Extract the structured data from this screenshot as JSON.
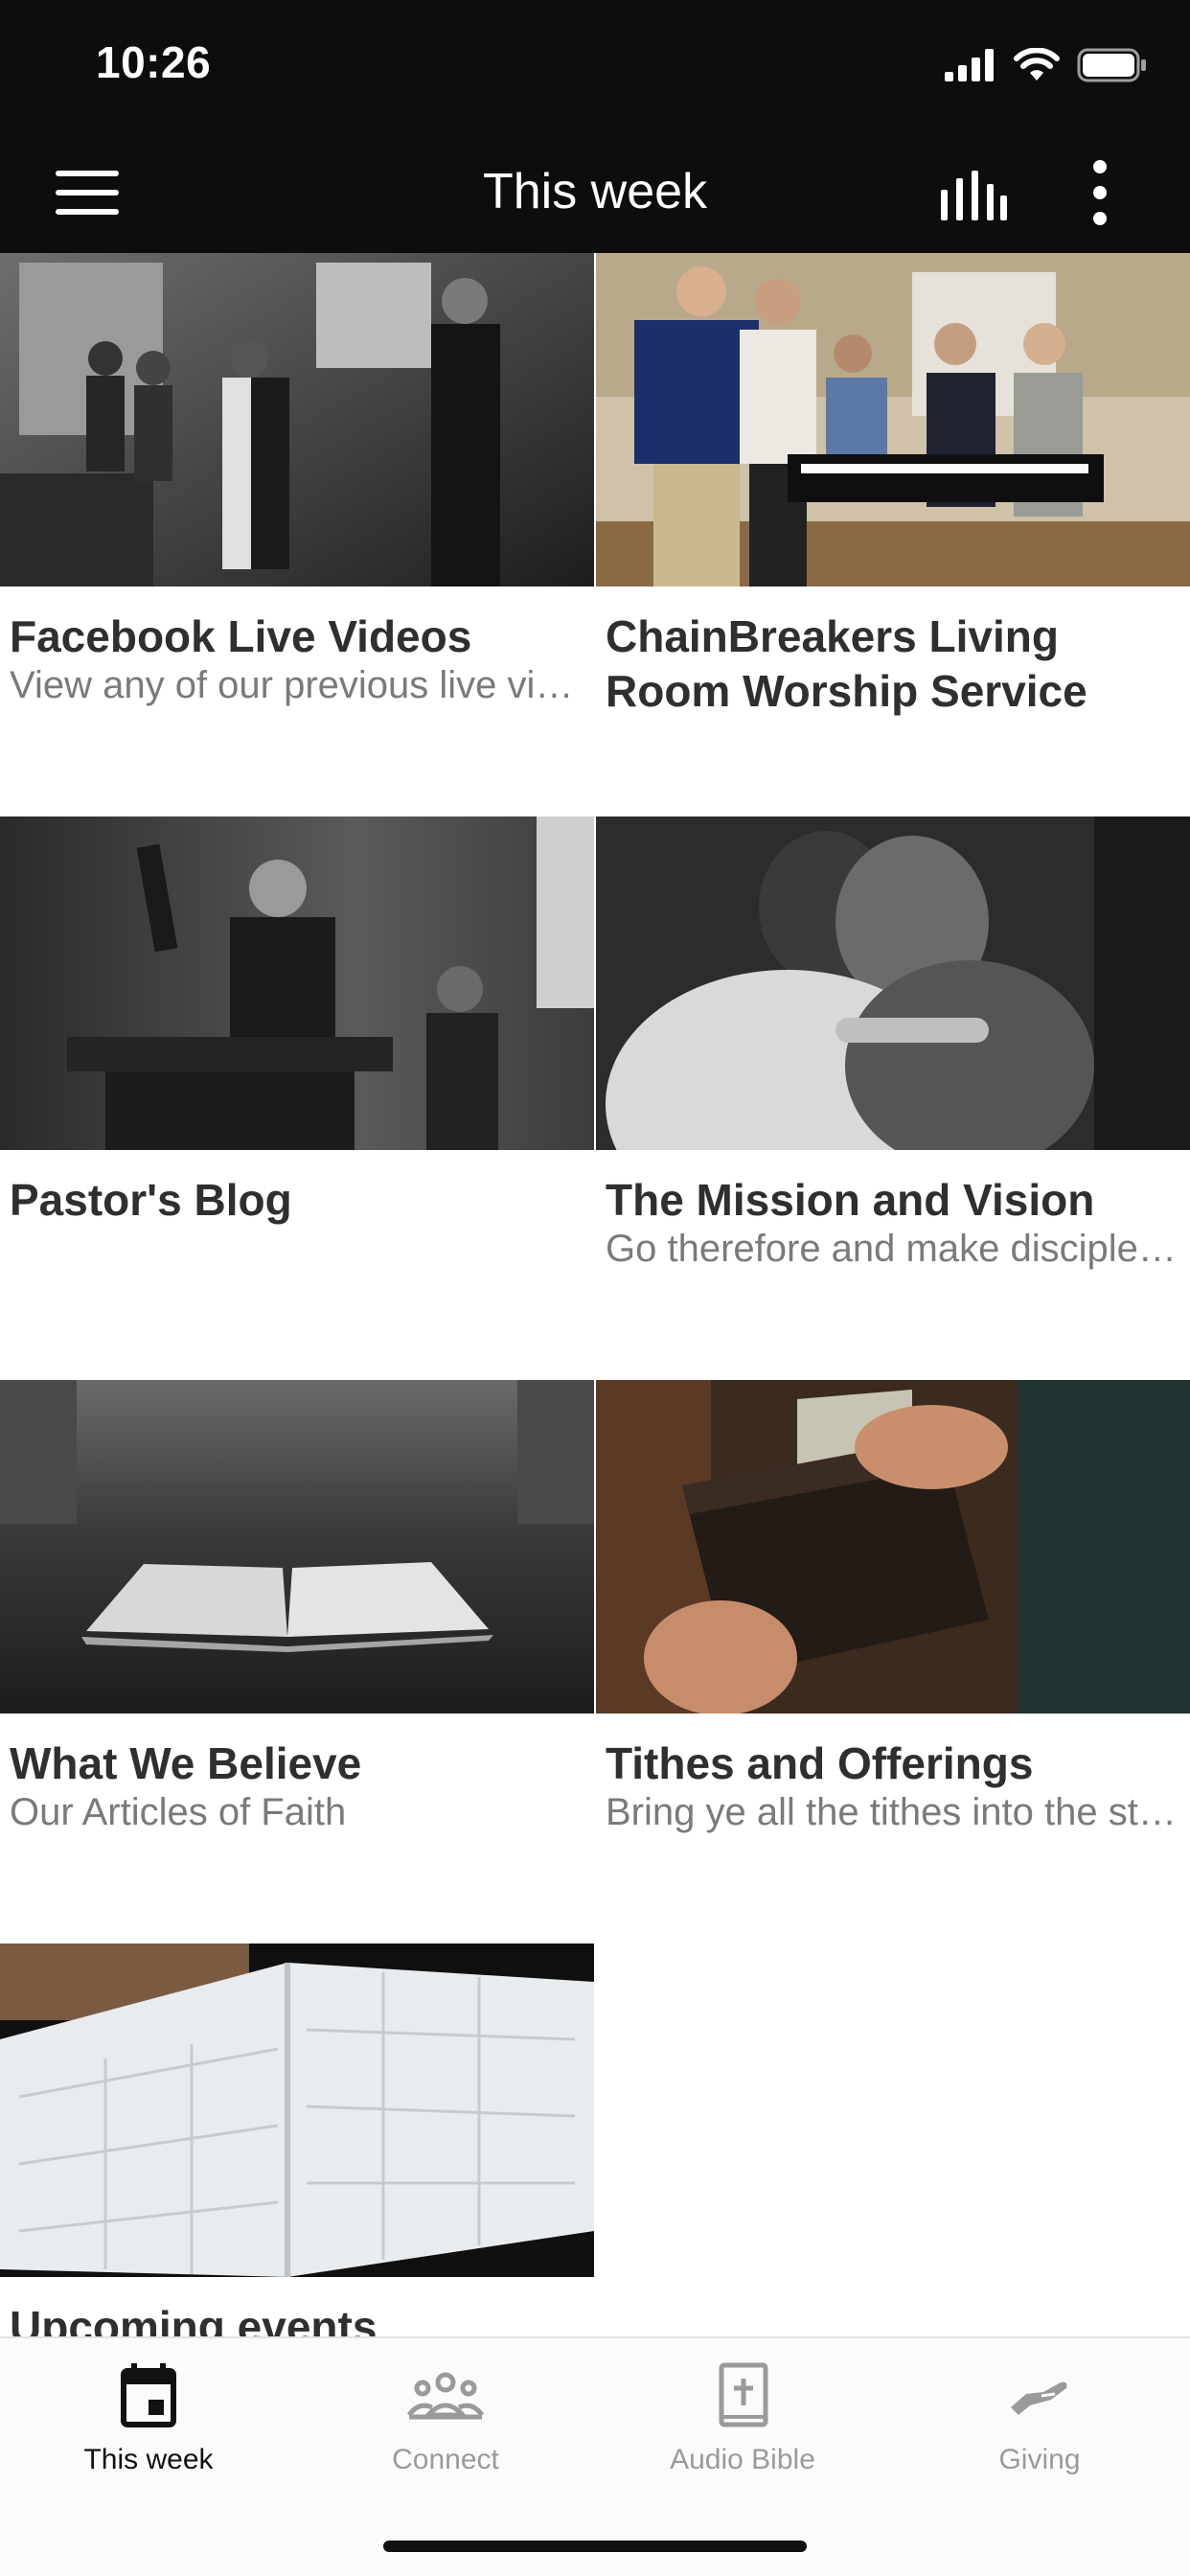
{
  "status_bar": {
    "time": "10:26"
  },
  "header": {
    "title": "This week"
  },
  "tiles": [
    {
      "title": "Facebook Live Videos",
      "subtitle": "View any of our previous live videos"
    },
    {
      "title": "ChainBreakers Living Room Worship Service",
      "subtitle": ""
    },
    {
      "title": "Pastor's Blog",
      "subtitle": ""
    },
    {
      "title": "The Mission and Vision",
      "subtitle": "Go therefore and make disciples of all nations"
    },
    {
      "title": "What We Believe",
      "subtitle": "Our Articles of Faith"
    },
    {
      "title": "Tithes and Offerings",
      "subtitle": "Bring ye all the tithes into the storehouse"
    },
    {
      "title": "Upcoming events",
      "subtitle": ""
    }
  ],
  "tab_bar": {
    "tabs": [
      {
        "label": "This week",
        "icon": "calendar-icon",
        "active": true
      },
      {
        "label": "Connect",
        "icon": "people-icon",
        "active": false
      },
      {
        "label": "Audio Bible",
        "icon": "bible-icon",
        "active": false
      },
      {
        "label": "Giving",
        "icon": "giving-hand-icon",
        "active": false
      }
    ]
  },
  "colors": {
    "header_bg": "#0d0d0e",
    "active_tab": "#111111",
    "inactive_tab": "#9a9a9a"
  }
}
